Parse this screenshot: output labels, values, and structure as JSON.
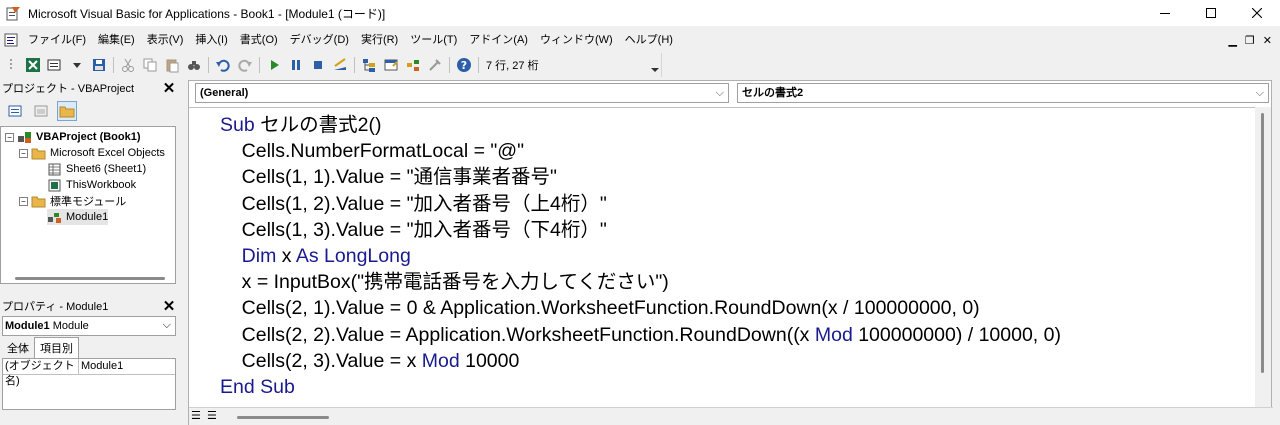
{
  "window": {
    "title": "Microsoft Visual Basic for Applications - Book1 - [Module1 (コード)]"
  },
  "menu": {
    "items": [
      "ファイル(F)",
      "編集(E)",
      "表示(V)",
      "挿入(I)",
      "書式(O)",
      "デバッグ(D)",
      "実行(R)",
      "ツール(T)",
      "アドイン(A)",
      "ウィンドウ(W)",
      "ヘルプ(H)"
    ]
  },
  "toolbar": {
    "cursor_position": "7 行, 27 桁"
  },
  "project": {
    "title": "プロジェクト - VBAProject",
    "tree": [
      {
        "label": "VBAProject (Book1)",
        "bold": true
      },
      {
        "label": "Microsoft Excel Objects"
      },
      {
        "label": "Sheet6 (Sheet1)"
      },
      {
        "label": "ThisWorkbook"
      },
      {
        "label": "標準モジュール"
      },
      {
        "label": "Module1"
      }
    ]
  },
  "properties": {
    "title": "プロパティ - Module1",
    "object_name": "Module1",
    "object_type": "Module",
    "tabs": [
      "全体",
      "項目別"
    ],
    "rows": [
      {
        "name": "(オブジェクト名)",
        "value": "Module1"
      }
    ]
  },
  "code": {
    "object_combo": "(General)",
    "procedure_combo": "セルの書式2",
    "lines": [
      "Sub セルの書式2()",
      "    Cells.NumberFormatLocal = \"@\"",
      "    Cells(1, 1).Value = \"通信事業者番号\"",
      "    Cells(1, 2).Value = \"加入者番号（上4桁）\"",
      "    Cells(1, 3).Value = \"加入者番号（下4桁）\"",
      "    Dim x As LongLong",
      "    x = InputBox(\"携帯電話番号を入力してください\")",
      "    Cells(2, 1).Value = 0 & Application.WorksheetFunction.RoundDown(x / 100000000, 0)",
      "    Cells(2, 2).Value = Application.WorksheetFunction.RoundDown((x Mod 100000000) / 10000, 0)",
      "    Cells(2, 3).Value = x Mod 10000",
      "End Sub"
    ]
  }
}
